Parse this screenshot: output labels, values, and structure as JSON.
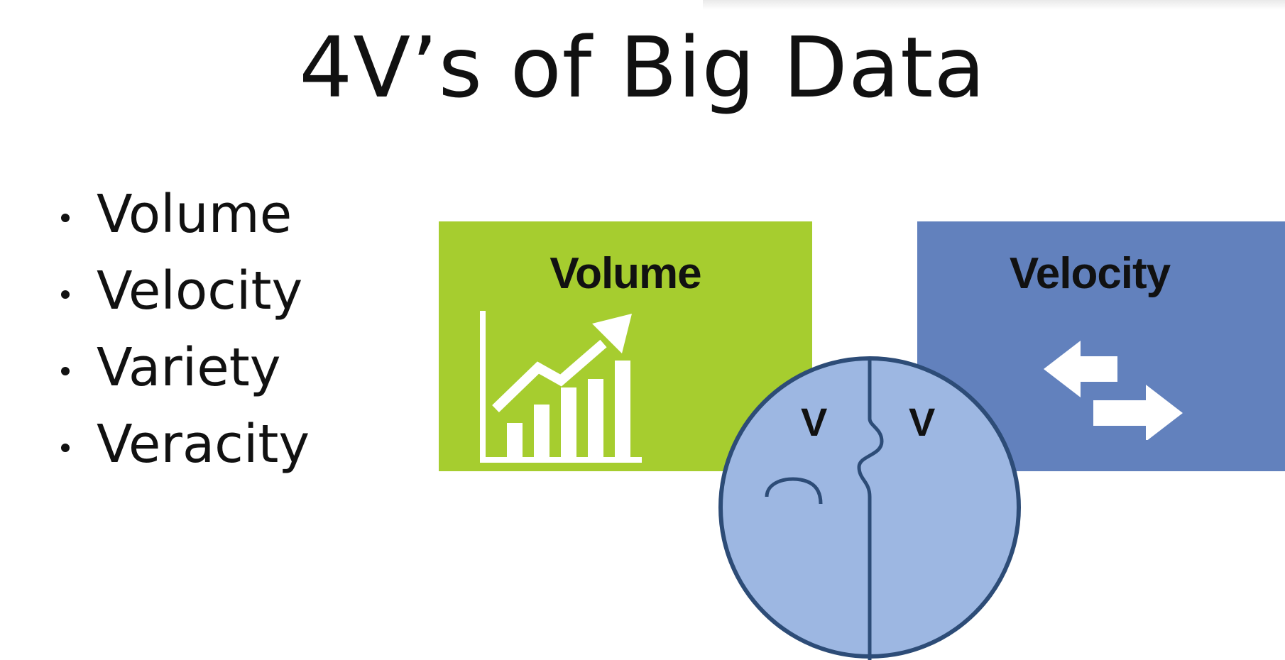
{
  "slide": {
    "title": "4V’s of Big Data"
  },
  "bullets": [
    "Volume",
    "Velocity",
    "Variety",
    "Veracity"
  ],
  "diagram": {
    "tiles": [
      {
        "label": "Volume",
        "color": "#a6cd2f",
        "icon": "growth-chart-icon"
      },
      {
        "label": "Velocity",
        "color": "#6281bd",
        "icon": "exchange-arrows-icon"
      }
    ],
    "center": {
      "color": "#9db7e2",
      "outline": "#2d4c77",
      "icon": "puzzle-pieces-icon",
      "letters": [
        "V",
        "V"
      ]
    }
  }
}
